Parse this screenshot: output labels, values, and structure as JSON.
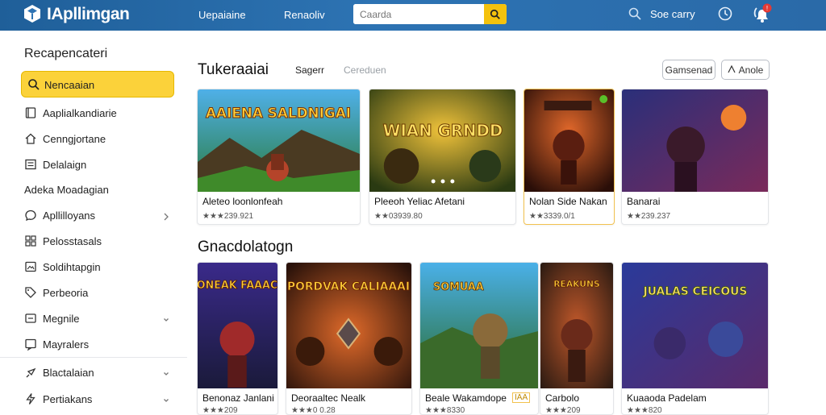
{
  "header": {
    "brand": "IApllimgan",
    "nav": [
      "Uepaiaine",
      "Renaoliv"
    ],
    "search_placeholder": "Caarda",
    "link": "Soe carry",
    "notification_count": "!"
  },
  "sidebar": {
    "title": "Recapencateri",
    "active": {
      "label": "Nencaaian",
      "icon": "search-icon"
    },
    "items": [
      {
        "label": "Aaplialkandiarie",
        "icon": "book-icon"
      },
      {
        "label": "Cenngjortane",
        "icon": "home-icon"
      },
      {
        "label": "Delalaign",
        "icon": "list-icon"
      },
      {
        "label": "Adeka Moadagian",
        "icon": ""
      },
      {
        "label": "Apllilloyans",
        "icon": "chat-icon",
        "chevron": true
      },
      {
        "label": "Pelosstasals",
        "icon": "grid-icon"
      },
      {
        "label": "Soldihtapgin",
        "icon": "image-icon"
      },
      {
        "label": "Perbeoria",
        "icon": "tag-icon"
      },
      {
        "label": "Megnile",
        "icon": "folder-icon",
        "chevron": true
      },
      {
        "label": "Mayralers",
        "icon": "message-icon"
      },
      {
        "label": "Blactalaian",
        "icon": "pin-icon",
        "chevron": true
      },
      {
        "label": "Pertiakans",
        "icon": "bolt-icon",
        "chevron": true
      }
    ]
  },
  "featured": {
    "title": "Tukeraaiai",
    "tabs": [
      "Sagerr",
      "Cereduen"
    ],
    "button_primary": "Gamsenad",
    "button_secondary": "Anole",
    "cards": [
      {
        "title": "Aleteo loonlonfeah",
        "rating": "★★★239.921",
        "art_text": "AAIENA SALDNIGAI"
      },
      {
        "title": "Pleeoh Yeliac Afetani",
        "rating": "★★03939.80",
        "art_text": "WIAN GRNDD"
      },
      {
        "title": "Nolan Side Nakan",
        "rating": "★★3339.0/1",
        "art_text": ""
      },
      {
        "title": "Banarai",
        "rating": "★★239.237",
        "art_text": ""
      }
    ]
  },
  "catalog": {
    "title": "Gnacdolatogn",
    "cards": [
      {
        "title": "Benonaz Janlani",
        "rating": "★★★209",
        "art_text": "RONEAK FAAACK"
      },
      {
        "title": "Deoraaltec Nealk",
        "rating": "★★★0 0.28",
        "art_text": "PORDVAK CALIAAAI"
      },
      {
        "title": "Beale Wakamdope",
        "rating": "★★★8330",
        "badge": "IAA",
        "art_text": "SOMUAA"
      },
      {
        "title": "Carbolo",
        "rating": "★★★209",
        "art_text": "REAKUNS"
      },
      {
        "title": "Kuaaoda Padelam",
        "rating": "★★★820",
        "art_text": "JUALAS CEICOUS"
      }
    ]
  }
}
